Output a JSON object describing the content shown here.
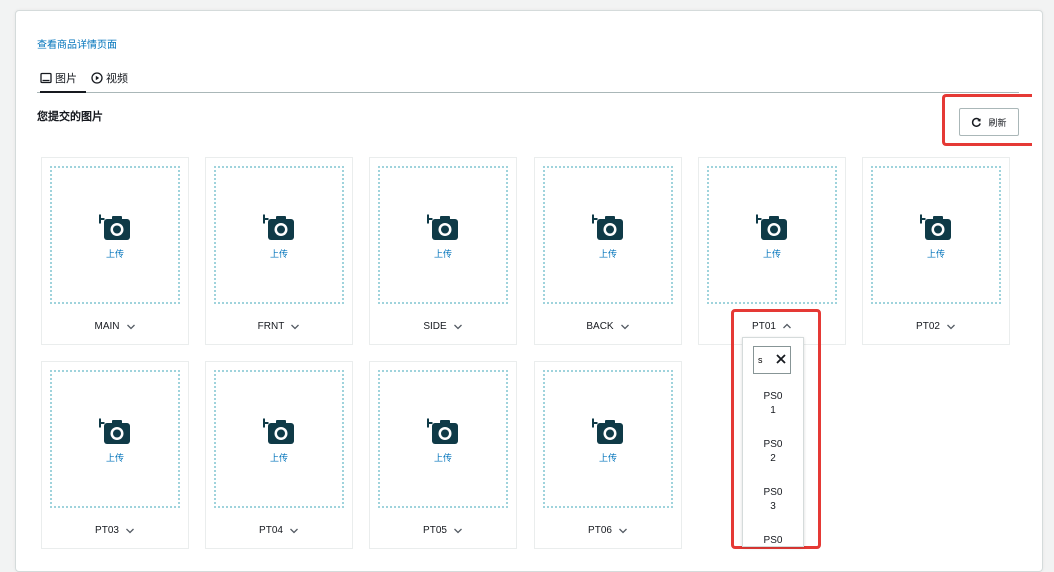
{
  "header": {
    "view_link": "查看商品详情页面"
  },
  "tabs": [
    {
      "label": "图片",
      "icon": "image-icon",
      "active": true
    },
    {
      "label": "视频",
      "icon": "play-circle-icon",
      "active": false
    }
  ],
  "section": {
    "title": "您提交的图片"
  },
  "refresh": {
    "label": "刷新",
    "icon": "refresh-icon"
  },
  "slots": [
    {
      "label": "MAIN",
      "upload_label": "上传",
      "icon": "camera-add-icon",
      "expanded": false
    },
    {
      "label": "FRNT",
      "upload_label": "上传",
      "icon": "camera-add-icon",
      "expanded": false
    },
    {
      "label": "SIDE",
      "upload_label": "上传",
      "icon": "camera-add-icon",
      "expanded": false
    },
    {
      "label": "BACK",
      "upload_label": "上传",
      "icon": "camera-add-icon",
      "expanded": false
    },
    {
      "label": "PT01",
      "upload_label": "上传",
      "icon": "camera-add-icon",
      "expanded": true
    },
    {
      "label": "PT02",
      "upload_label": "上传",
      "icon": "camera-add-icon",
      "expanded": false
    },
    {
      "label": "PT03",
      "upload_label": "上传",
      "icon": "camera-add-icon",
      "expanded": false
    },
    {
      "label": "PT04",
      "upload_label": "上传",
      "icon": "camera-add-icon",
      "expanded": false
    },
    {
      "label": "PT05",
      "upload_label": "上传",
      "icon": "camera-add-icon",
      "expanded": false
    },
    {
      "label": "PT06",
      "upload_label": "上传",
      "icon": "camera-add-icon",
      "expanded": false
    }
  ],
  "dropdown": {
    "search_value": "s",
    "options": [
      {
        "line1": "PS0",
        "line2": "1"
      },
      {
        "line1": "PS0",
        "line2": "2"
      },
      {
        "line1": "PS0",
        "line2": "3"
      },
      {
        "line1": "PS0",
        "line2": ""
      }
    ]
  },
  "colors": {
    "highlight": "#e53935",
    "link": "#0073bb",
    "dropzone_border": "#9fd3dc",
    "camera_icon": "#0f3a47"
  }
}
